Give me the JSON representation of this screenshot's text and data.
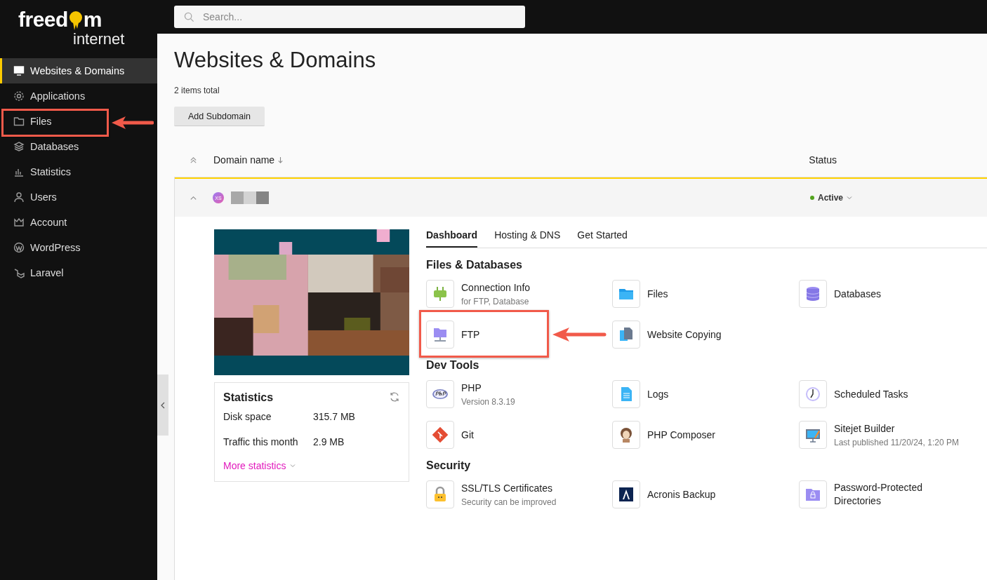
{
  "sidebar": {
    "logo": {
      "word_start": "freed",
      "word_end": "m",
      "tagline": "internet"
    },
    "items": [
      {
        "label": "Websites & Domains",
        "selected": true,
        "highlighted": false
      },
      {
        "label": "Applications",
        "selected": false,
        "highlighted": false
      },
      {
        "label": "Files",
        "selected": false,
        "highlighted": true
      },
      {
        "label": "Databases",
        "selected": false,
        "highlighted": false
      },
      {
        "label": "Statistics",
        "selected": false,
        "highlighted": false
      },
      {
        "label": "Users",
        "selected": false,
        "highlighted": false
      },
      {
        "label": "Account",
        "selected": false,
        "highlighted": false
      },
      {
        "label": "WordPress",
        "selected": false,
        "highlighted": false
      },
      {
        "label": "Laravel",
        "selected": false,
        "highlighted": false
      }
    ]
  },
  "search": {
    "placeholder": "Search..."
  },
  "page": {
    "title": "Websites & Domains",
    "count": "2 items total",
    "add_button": "Add Subdomain"
  },
  "table": {
    "columns": [
      "Domain name",
      "Status"
    ]
  },
  "domain": {
    "avatar": "XS",
    "expanded": true,
    "status": "Active"
  },
  "statistics": {
    "title": "Statistics",
    "rows": [
      {
        "label": "Disk space",
        "value": "315.7 MB"
      },
      {
        "label": "Traffic this month",
        "value": "2.9 MB"
      }
    ],
    "more_link": "More statistics"
  },
  "tabs": [
    {
      "label": "Dashboard",
      "selected": true
    },
    {
      "label": "Hosting & DNS",
      "selected": false
    },
    {
      "label": "Get Started",
      "selected": false
    }
  ],
  "sections": [
    {
      "title": "Files & Databases",
      "tools": [
        {
          "name": "Connection Info",
          "note": "for FTP, Database",
          "highlighted": false
        },
        {
          "name": "Files",
          "highlighted": false
        },
        {
          "name": "Databases",
          "highlighted": false
        },
        {
          "name": "FTP",
          "highlighted": true
        },
        {
          "name": "Website Copying",
          "highlighted": false
        }
      ]
    },
    {
      "title": "Dev Tools",
      "tools": [
        {
          "name": "PHP",
          "note": "Version 8.3.19",
          "highlighted": false
        },
        {
          "name": "Logs",
          "highlighted": false
        },
        {
          "name": "Scheduled Tasks",
          "highlighted": false
        },
        {
          "name": "Git",
          "highlighted": false
        },
        {
          "name": "PHP Composer",
          "highlighted": false
        },
        {
          "name": "Sitejet Builder",
          "note": "Last published 11/20/24, 1:20 PM",
          "highlighted": false
        }
      ]
    },
    {
      "title": "Security",
      "tools": [
        {
          "name": "SSL/TLS Certificates",
          "note": "Security can be improved",
          "highlighted": false
        },
        {
          "name": "Acronis Backup",
          "highlighted": false
        },
        {
          "name": "Password-Protected Directories",
          "highlighted": false
        }
      ]
    }
  ]
}
